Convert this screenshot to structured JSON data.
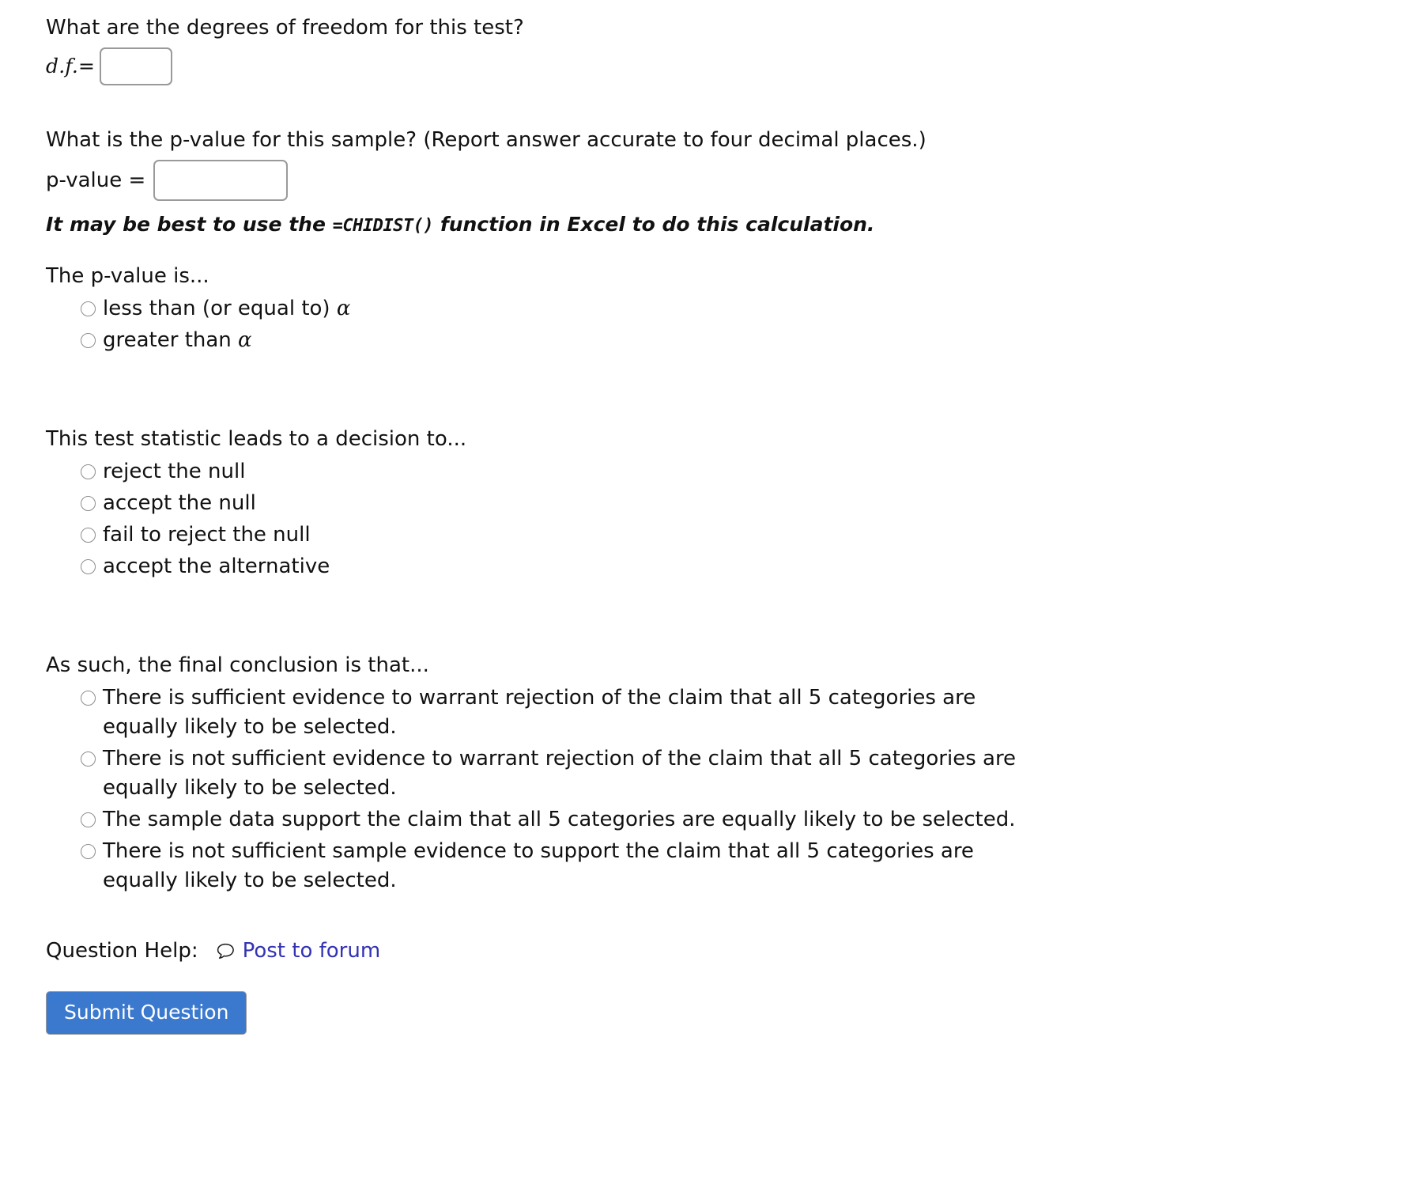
{
  "questions": {
    "df": {
      "prompt": "What are the degrees of freedom for this test?",
      "label": "d.f.=",
      "value": "",
      "placeholder": ""
    },
    "pvalue": {
      "prompt": "What is the p-value for this sample? (Report answer accurate to four decimal places.)",
      "label": "p-value =",
      "value": "",
      "placeholder": "",
      "hint_before": "It may be best to use the",
      "hint_code": "=CHIDIST()",
      "hint_after": "function in Excel to do this calculation."
    }
  },
  "pvalue_comparison": {
    "title": "The p-value is...",
    "options": [
      {
        "text_before": "less than (or equal to) ",
        "symbol": "α"
      },
      {
        "text_before": "greater than ",
        "symbol": "α"
      }
    ]
  },
  "decision": {
    "title": "This test statistic leads to a decision to...",
    "options": [
      {
        "label": "reject the null"
      },
      {
        "label": "accept the null"
      },
      {
        "label": "fail to reject the null"
      },
      {
        "label": "accept the alternative"
      }
    ]
  },
  "conclusion": {
    "title": "As such, the final conclusion is that...",
    "options": [
      {
        "label": "There is sufficient evidence to warrant rejection of the claim that all 5 categories are equally likely to be selected."
      },
      {
        "label": "There is not sufficient evidence to warrant rejection of the claim that all 5 categories are equally likely to be selected."
      },
      {
        "label": "The sample data support the claim that all 5 categories are equally likely to be selected."
      },
      {
        "label": "There is not sufficient sample evidence to support the claim that all 5 categories are equally likely to be selected."
      }
    ]
  },
  "footer": {
    "help_label": "Question Help:",
    "forum_link": "Post to forum",
    "forum_icon": "speech-bubble-icon",
    "submit_label": "Submit Question",
    "link_color": "#3333b4",
    "button_color": "#3b79ce"
  }
}
